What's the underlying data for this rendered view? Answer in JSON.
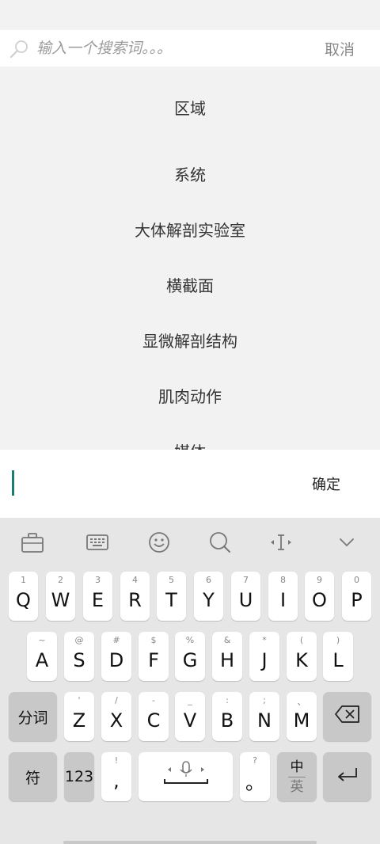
{
  "search": {
    "placeholder": "输入一个搜索词。。。",
    "cancel_label": "取消"
  },
  "list": {
    "items": [
      "区域",
      "系统",
      "大体解剖实验室",
      "横截面",
      "显微解剖结构",
      "肌肉动作",
      "媒体"
    ]
  },
  "input_row": {
    "confirm_label": "确定"
  },
  "keyboard": {
    "row1": [
      {
        "hint": "1",
        "key": "Q"
      },
      {
        "hint": "2",
        "key": "W"
      },
      {
        "hint": "3",
        "key": "E"
      },
      {
        "hint": "4",
        "key": "R"
      },
      {
        "hint": "5",
        "key": "T"
      },
      {
        "hint": "6",
        "key": "Y"
      },
      {
        "hint": "7",
        "key": "U"
      },
      {
        "hint": "8",
        "key": "I"
      },
      {
        "hint": "9",
        "key": "O"
      },
      {
        "hint": "0",
        "key": "P"
      }
    ],
    "row2": [
      {
        "hint": "~",
        "key": "A"
      },
      {
        "hint": "@",
        "key": "S"
      },
      {
        "hint": "#",
        "key": "D"
      },
      {
        "hint": "$",
        "key": "F"
      },
      {
        "hint": "%",
        "key": "G"
      },
      {
        "hint": "&",
        "key": "H"
      },
      {
        "hint": "*",
        "key": "J"
      },
      {
        "hint": "(",
        "key": "K"
      },
      {
        "hint": ")",
        "key": "L"
      }
    ],
    "row3": [
      {
        "hint": "'",
        "key": "Z"
      },
      {
        "hint": "/",
        "key": "X"
      },
      {
        "hint": "-",
        "key": "C"
      },
      {
        "hint": "_",
        "key": "V"
      },
      {
        "hint": ":",
        "key": "B"
      },
      {
        "hint": ";",
        "key": "N"
      },
      {
        "hint": "、",
        "key": "M"
      }
    ],
    "segment_label": "分词",
    "symbols_label": "符",
    "numbers_label": "123",
    "comma_hint": "!",
    "comma_key": ",",
    "period_hint": "?",
    "period_key": "。",
    "lang_top": "中",
    "lang_bottom": "英"
  },
  "colors": {
    "cursor": "#1a7f6f",
    "keyboard_bg": "#e6e6e6",
    "key_bg": "#ffffff",
    "function_key_bg": "#c8c8c8"
  }
}
